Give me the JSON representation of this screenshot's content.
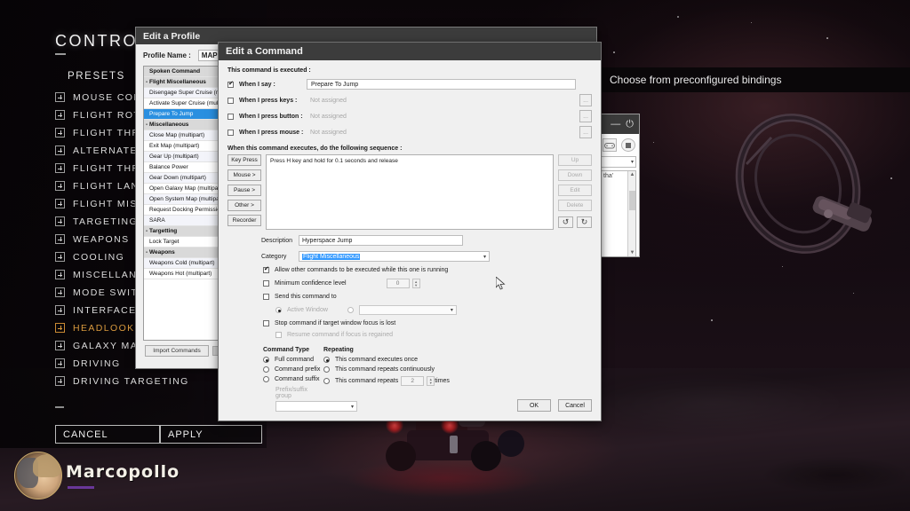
{
  "game": {
    "panel_title": "CONTROLS",
    "presets_label": "PRESETS",
    "categories": [
      {
        "label": "MOUSE CONTROLS",
        "highlighted": false
      },
      {
        "label": "FLIGHT ROTATION",
        "highlighted": false
      },
      {
        "label": "FLIGHT THRUST",
        "highlighted": false
      },
      {
        "label": "ALTERNATE FLIGHT CONTROLS",
        "highlighted": false
      },
      {
        "label": "FLIGHT THROTTLE",
        "highlighted": false
      },
      {
        "label": "FLIGHT LANDING OVERRIDES",
        "highlighted": false
      },
      {
        "label": "FLIGHT MISCELLANEOUS",
        "highlighted": false
      },
      {
        "label": "TARGETING",
        "highlighted": false
      },
      {
        "label": "WEAPONS",
        "highlighted": false
      },
      {
        "label": "COOLING",
        "highlighted": false
      },
      {
        "label": "MISCELLANEOUS",
        "highlighted": false
      },
      {
        "label": "MODE SWITCHES",
        "highlighted": false
      },
      {
        "label": "INTERFACE MODE",
        "highlighted": false
      },
      {
        "label": "HEADLOOK MODE",
        "highlighted": true
      },
      {
        "label": "GALAXY MAP",
        "highlighted": false
      },
      {
        "label": "DRIVING",
        "highlighted": false
      },
      {
        "label": "DRIVING TARGETING",
        "highlighted": false
      }
    ],
    "cancel_button": "CANCEL",
    "apply_button": "APPLY",
    "player_name": "Marcopollo",
    "tooltip": "Choose from preconfigured bindings",
    "highlight_color": "#d99a3e"
  },
  "profile_dialog": {
    "title": "Edit a Profile",
    "profile_name_label": "Profile Name :",
    "profile_name_value": "MAP",
    "list_header": "Spoken Command",
    "import_button": "Import Commands",
    "commands": [
      {
        "label": "Spoken Command",
        "type": "listheader"
      },
      {
        "label": "Flight Miscellaneous",
        "type": "group"
      },
      {
        "label": "Disengage Super Cruise (multipart)",
        "type": "item"
      },
      {
        "label": "Activate Super Cruise (multipart)",
        "type": "item"
      },
      {
        "label": "Prepare To Jump",
        "type": "selected"
      },
      {
        "label": "Miscellaneous",
        "type": "group"
      },
      {
        "label": "Close Map (multipart)",
        "type": "item"
      },
      {
        "label": "Exit Map (multipart)",
        "type": "item"
      },
      {
        "label": "Gear Up (multipart)",
        "type": "item"
      },
      {
        "label": "Balance Power",
        "type": "item"
      },
      {
        "label": "Gear Down (multipart)",
        "type": "item"
      },
      {
        "label": "Open Galaxy Map (multipart)",
        "type": "item"
      },
      {
        "label": "Open System Map (multipart)",
        "type": "item"
      },
      {
        "label": "Request Docking Permission",
        "type": "item"
      },
      {
        "label": "SARA",
        "type": "item"
      },
      {
        "label": "Targetting",
        "type": "group"
      },
      {
        "label": "Lock Target",
        "type": "item"
      },
      {
        "label": "Weapons",
        "type": "group"
      },
      {
        "label": "Weapons Cold (multipart)",
        "type": "item"
      },
      {
        "label": "Weapons Hot (multipart)",
        "type": "item"
      }
    ]
  },
  "command_dialog": {
    "title": "Edit a Command",
    "executed_label": "This command is executed :",
    "triggers": [
      {
        "label": "When I say :",
        "checked": true,
        "value": "Prepare To Jump",
        "has_browse": false
      },
      {
        "label": "When I press keys :",
        "checked": false,
        "value": "Not assigned",
        "has_browse": true
      },
      {
        "label": "When I press button :",
        "checked": false,
        "value": "Not assigned",
        "has_browse": true
      },
      {
        "label": "When I press mouse :",
        "checked": false,
        "value": "Not assigned",
        "has_browse": true
      }
    ],
    "sequence_label": "When this command executes, do the following sequence :",
    "sequence_buttons": [
      "Key Press",
      "Mouse >",
      "Pause >",
      "Other >",
      "Recorder"
    ],
    "sequence_items": [
      "Press H key and hold for 0.1 seconds and release"
    ],
    "list_action_buttons": [
      "Up",
      "Down",
      "Edit",
      "Delete"
    ],
    "undo_label": "undo",
    "redo_label": "redo",
    "description_label": "Description",
    "description_value": "Hyperspace Jump",
    "category_label": "Category",
    "category_value": "Flight Miscellaneous",
    "allow_other_label": "Allow other commands to be executed while this one is running",
    "allow_other_checked": true,
    "min_confidence_label": "Minimum confidence level",
    "min_confidence_value": "0",
    "min_confidence_checked": false,
    "send_to_label": "Send this command to",
    "send_to_checked": false,
    "active_window_label": "Active Window",
    "active_window_selected": true,
    "target_window_value": "",
    "stop_focus_label": "Stop command if target window focus is lost",
    "stop_focus_checked": false,
    "resume_focus_label": "Resume command if focus is regained",
    "resume_focus_checked": false,
    "command_type_header": "Command Type",
    "command_type_options": [
      {
        "label": "Full command",
        "selected": true
      },
      {
        "label": "Command prefix",
        "selected": false
      },
      {
        "label": "Command suffix",
        "selected": false
      }
    ],
    "prefix_group_label": "Prefix/suffix group",
    "prefix_group_value": "",
    "repeating_header": "Repeating",
    "repeating_options": [
      {
        "label": "This command executes once",
        "selected": true
      },
      {
        "label": "This command repeats continuously",
        "selected": false
      },
      {
        "label": "This command repeats",
        "selected": false
      }
    ],
    "repeat_count": "2",
    "repeat_times_label": "times",
    "ok_button": "OK",
    "cancel_button": "Cancel",
    "selection_color": "#3399ff"
  },
  "background_window": {
    "minimize_label": "—",
    "power_label": "⏻",
    "gamepad_icon": "gamepad-icon",
    "stop_icon": "stop-icon",
    "list_text": "tha'"
  }
}
